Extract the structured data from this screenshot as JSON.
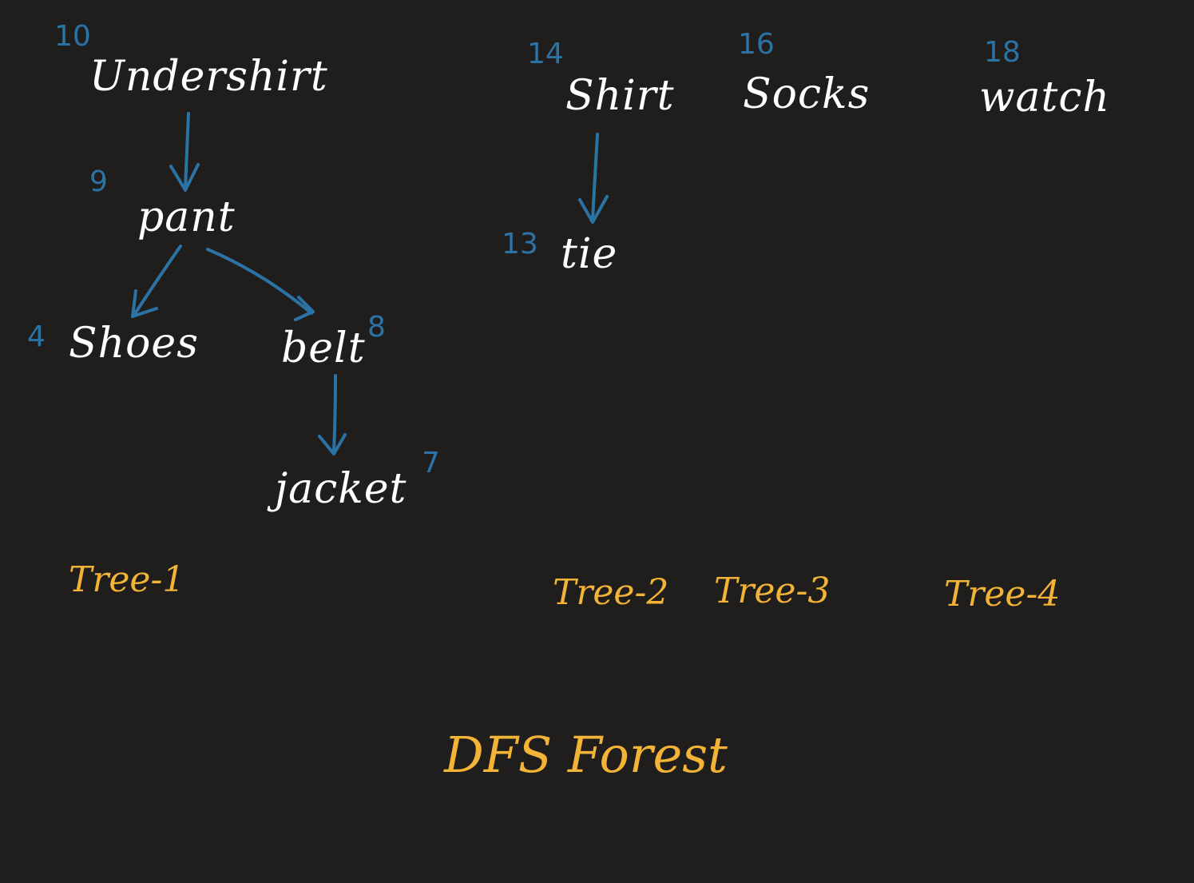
{
  "colors": {
    "background": "#1f1e1d",
    "node_text": "#ffffff",
    "number_text": "#2c73a5",
    "edge": "#2c73a5",
    "caption_text": "#f2b336"
  },
  "title": "DFS Forest",
  "nodes": {
    "undershirt": {
      "label": "Undershirt",
      "number": "10"
    },
    "pant": {
      "label": "pant",
      "number": "9"
    },
    "shoes": {
      "label": "Shoes",
      "number": "4"
    },
    "belt": {
      "label": "belt",
      "number": "8"
    },
    "jacket": {
      "label": "jacket",
      "number": "7"
    },
    "shirt": {
      "label": "Shirt",
      "number": "14"
    },
    "tie": {
      "label": "tie",
      "number": "13"
    },
    "socks": {
      "label": "Socks",
      "number": "16"
    },
    "watch": {
      "label": "watch",
      "number": "18"
    }
  },
  "edges": [
    {
      "from": "undershirt",
      "to": "pant"
    },
    {
      "from": "pant",
      "to": "shoes"
    },
    {
      "from": "pant",
      "to": "belt"
    },
    {
      "from": "belt",
      "to": "jacket"
    },
    {
      "from": "shirt",
      "to": "tie"
    }
  ],
  "trees": [
    {
      "label": "Tree-1"
    },
    {
      "label": "Tree-2"
    },
    {
      "label": "Tree-3"
    },
    {
      "label": "Tree-4"
    }
  ]
}
